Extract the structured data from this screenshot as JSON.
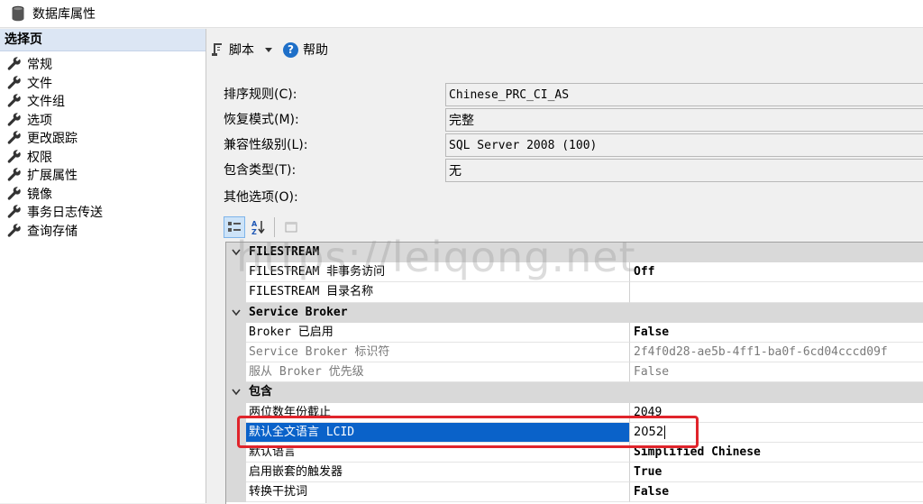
{
  "window": {
    "title": "数据库属性"
  },
  "sidebar": {
    "header": "选择页",
    "items": [
      {
        "label": "常规"
      },
      {
        "label": "文件"
      },
      {
        "label": "文件组"
      },
      {
        "label": "选项"
      },
      {
        "label": "更改跟踪"
      },
      {
        "label": "权限"
      },
      {
        "label": "扩展属性"
      },
      {
        "label": "镜像"
      },
      {
        "label": "事务日志传送"
      },
      {
        "label": "查询存储"
      }
    ]
  },
  "toolbar": {
    "script_label": "脚本",
    "help_label": "帮助"
  },
  "properties": {
    "collation": {
      "label": "排序规则(C):",
      "value": "Chinese_PRC_CI_AS"
    },
    "recovery": {
      "label": "恢复模式(M):",
      "value": "完整"
    },
    "compat": {
      "label": "兼容性级别(L):",
      "value": "SQL Server 2008 (100)"
    },
    "containment": {
      "label": "包含类型(T):",
      "value": "无"
    },
    "other_label": "其他选项(O):"
  },
  "grid": {
    "cat_filestream": "FILESTREAM",
    "fs_nontx": {
      "name": "FILESTREAM 非事务访问",
      "value": "Off"
    },
    "fs_dir": {
      "name": "FILESTREAM 目录名称",
      "value": ""
    },
    "cat_broker": "Service Broker",
    "broker_enabled": {
      "name": "Broker 已启用",
      "value": "False"
    },
    "broker_id": {
      "name": "Service Broker 标识符",
      "value": "2f4f0d28-ae5b-4ff1-ba0f-6cd04cccd09f"
    },
    "broker_priority": {
      "name": "服从 Broker 优先级",
      "value": "False"
    },
    "cat_contain": "包含",
    "two_digit": {
      "name": "两位数年份截止",
      "value": "2049"
    },
    "lcid": {
      "name": "默认全文语言 LCID",
      "value": "2052"
    },
    "default_lang": {
      "name": "默认语言",
      "value": "Simplified Chinese"
    },
    "nested_triggers": {
      "name": "启用嵌套的触发器",
      "value": "True"
    },
    "noise": {
      "name": "转换干扰词",
      "value": "False"
    }
  },
  "watermark": "https://leiqong.net",
  "colors": {
    "selection": "#0a62c9",
    "highlight_border": "#e0242b",
    "category_bg": "#d9d9d9"
  }
}
